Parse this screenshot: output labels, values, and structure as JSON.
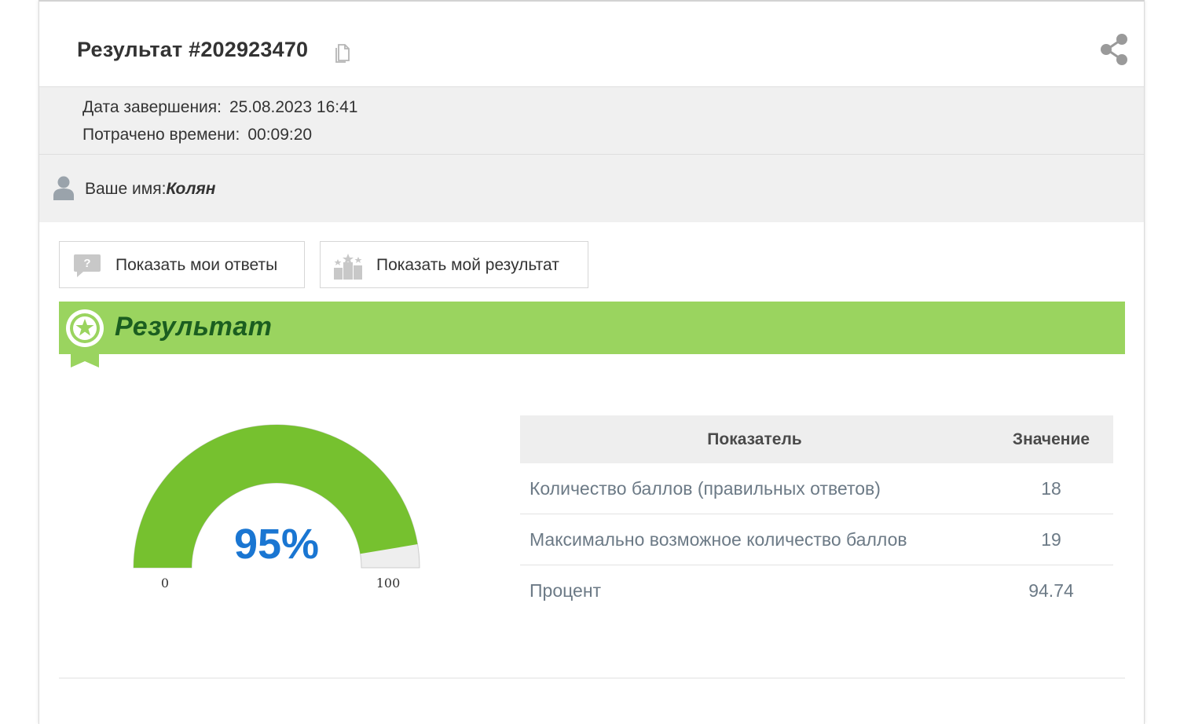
{
  "header": {
    "title": "Результат #202923470",
    "copy_icon": "copy-icon",
    "share_icon": "share-icon"
  },
  "meta": {
    "completion_label": "Дата завершения:",
    "completion_value": "25.08.2023 16:41",
    "time_label": "Потрачено времени:",
    "time_value": "00:09:20"
  },
  "user": {
    "name_label": "Ваше имя:",
    "name_value": "Колян",
    "icon": "user-icon"
  },
  "buttons": {
    "show_answers": "Показать мои ответы",
    "show_result": "Показать мой результат"
  },
  "result": {
    "banner_title": "Результат",
    "gauge": {
      "percent": 94.74,
      "display": "95%",
      "min_label": "0",
      "max_label": "100",
      "fill_color": "#76c12f",
      "rest_color": "#eeeeee",
      "value_color": "#1a76d2"
    },
    "table": {
      "headers": [
        "Показатель",
        "Значение"
      ],
      "rows": [
        {
          "indicator": "Количество баллов (правильных ответов)",
          "value": "18"
        },
        {
          "indicator": "Максимально возможное количество баллов",
          "value": "19"
        },
        {
          "indicator": "Процент",
          "value": "94.74"
        }
      ]
    }
  },
  "colors": {
    "banner": "#9ad45f",
    "banner_text": "#1b5e20",
    "panel_bg": "#f0f0f0"
  }
}
